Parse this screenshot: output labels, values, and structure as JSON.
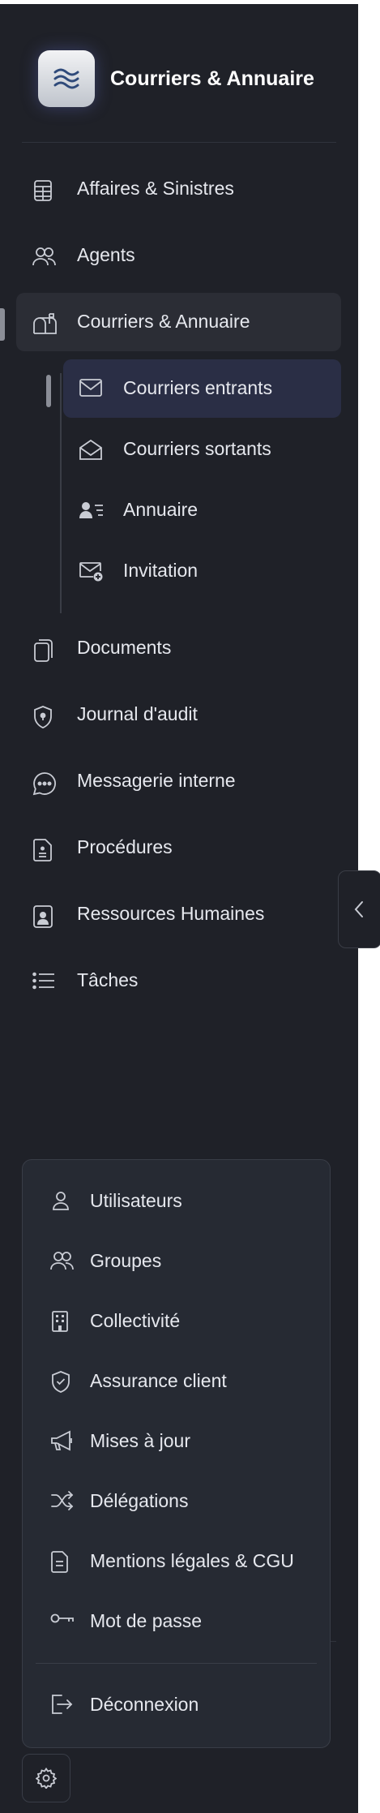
{
  "app": {
    "title": "Courriers & Annuaire"
  },
  "nav": {
    "items": [
      {
        "label": "Affaires & Sinistres",
        "icon": "calculator-icon"
      },
      {
        "label": "Agents",
        "icon": "users-icon"
      },
      {
        "label": "Courriers & Annuaire",
        "icon": "mailbox-icon",
        "active": true
      },
      {
        "label": "Documents",
        "icon": "documents-icon"
      },
      {
        "label": "Journal d'audit",
        "icon": "shield-lock-icon"
      },
      {
        "label": "Messagerie interne",
        "icon": "chat-bubble-icon"
      },
      {
        "label": "Procédures",
        "icon": "document-list-icon"
      },
      {
        "label": "Ressources Humaines",
        "icon": "id-badge-icon"
      },
      {
        "label": "Tâches",
        "icon": "list-icon"
      }
    ],
    "sub_items": [
      {
        "label": "Courriers entrants",
        "icon": "envelope-icon",
        "active": true
      },
      {
        "label": "Courriers sortants",
        "icon": "envelope-open-icon"
      },
      {
        "label": "Annuaire",
        "icon": "contact-list-icon"
      },
      {
        "label": "Invitation",
        "icon": "envelope-plus-icon"
      }
    ]
  },
  "menu": {
    "items": [
      {
        "label": "Utilisateurs",
        "icon": "user-icon"
      },
      {
        "label": "Groupes",
        "icon": "users-icon"
      },
      {
        "label": "Collectivité",
        "icon": "building-icon"
      },
      {
        "label": "Assurance client",
        "icon": "shield-check-icon"
      },
      {
        "label": "Mises à jour",
        "icon": "megaphone-icon"
      },
      {
        "label": "Délégations",
        "icon": "shuffle-icon"
      },
      {
        "label": "Mentions légales & CGU",
        "icon": "document-icon"
      },
      {
        "label": "Mot de passe",
        "icon": "key-icon"
      }
    ],
    "logout": {
      "label": "Déconnexion",
      "icon": "logout-icon"
    }
  },
  "colors": {
    "sidebar_bg": "#1f2128",
    "active_bg": "#2b2d35",
    "sub_active_bg": "#2a2e45",
    "popup_bg": "#262a33",
    "text": "#e6e8ee"
  }
}
